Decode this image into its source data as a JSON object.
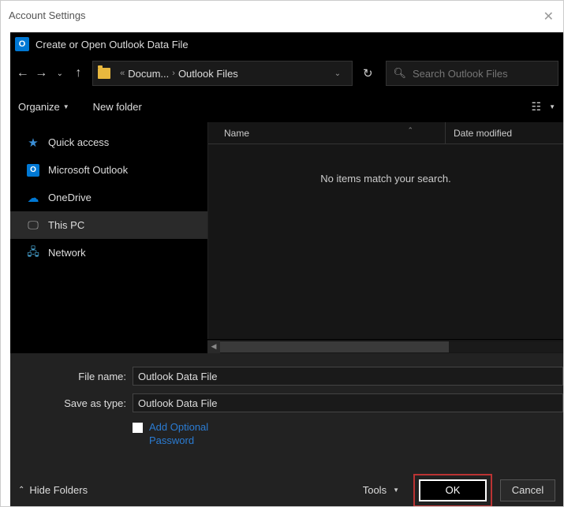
{
  "outer": {
    "title": "Account Settings"
  },
  "dialog": {
    "title": "Create or Open Outlook Data File",
    "breadcrumb": {
      "part1": "Docum...",
      "part2": "Outlook Files"
    },
    "search_placeholder": "Search Outlook Files"
  },
  "toolbar": {
    "organize": "Organize",
    "new_folder": "New folder"
  },
  "sidebar": {
    "items": [
      {
        "label": "Quick access"
      },
      {
        "label": "Microsoft Outlook"
      },
      {
        "label": "OneDrive"
      },
      {
        "label": "This PC"
      },
      {
        "label": "Network"
      }
    ]
  },
  "columns": {
    "name": "Name",
    "date": "Date modified"
  },
  "content": {
    "empty": "No items match your search."
  },
  "form": {
    "filename_label": "File name:",
    "filename_value": "Outlook Data File",
    "savetype_label": "Save as type:",
    "savetype_value": "Outlook Data File",
    "add_password": "Add Optional Password"
  },
  "footer": {
    "hide_folders": "Hide Folders",
    "tools": "Tools",
    "ok": "OK",
    "cancel": "Cancel"
  }
}
